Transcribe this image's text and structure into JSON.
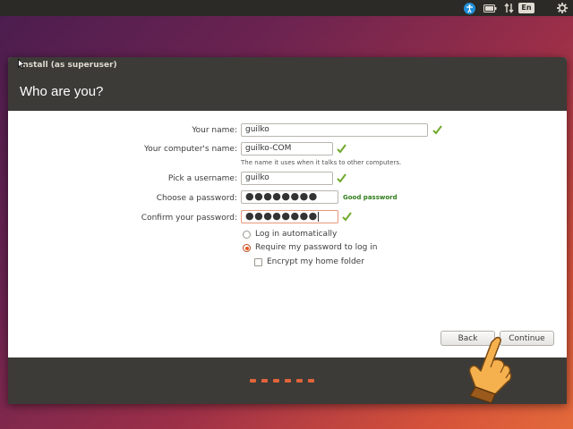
{
  "top_panel": {
    "icons": [
      "accessibility-icon",
      "battery-icon",
      "network-icon",
      "language-indicator",
      "settings-gear-icon"
    ],
    "language": "En"
  },
  "window": {
    "title": "Install (as superuser)",
    "heading": "Who are you?"
  },
  "form": {
    "name_label": "Your name:",
    "name_value": "guilko",
    "computer_label": "Your computer's name:",
    "computer_value": "guilko-COM",
    "computer_hint": "The name it uses when it talks to other computers.",
    "username_label": "Pick a username:",
    "username_value": "guilko",
    "password_label": "Choose a password:",
    "password_value": "●●●●●●●●",
    "password_strength": "Good password",
    "confirm_label": "Confirm your password:",
    "confirm_value": "●●●●●●●●",
    "login_auto_label": "Log in automatically",
    "require_password_label": "Require my password to log in",
    "encrypt_label": "Encrypt my home folder",
    "selected_login_option": "require_password",
    "encrypt_checked": false
  },
  "buttons": {
    "back": "Back",
    "continue": "Continue"
  },
  "progress": {
    "dots": 6
  },
  "colors": {
    "accent": "#e5561f",
    "titlebar": "#3c3b37",
    "check": "#6fa92a",
    "good_password": "#2f7d1a"
  }
}
